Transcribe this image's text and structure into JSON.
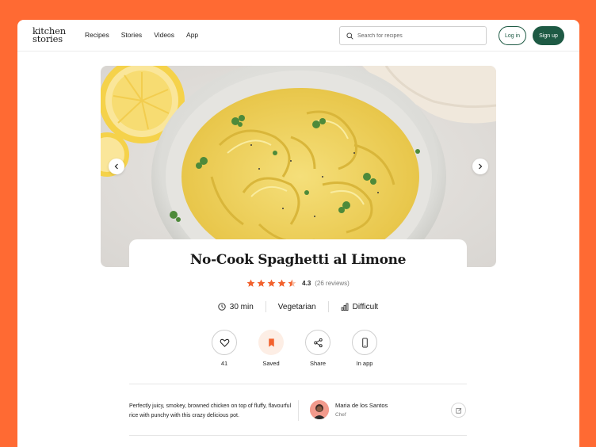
{
  "brand": {
    "line1": "kitchen",
    "line2": "stories"
  },
  "nav": [
    {
      "label": "Recipes"
    },
    {
      "label": "Stories"
    },
    {
      "label": "Videos"
    },
    {
      "label": "App"
    }
  ],
  "search": {
    "placeholder": "Search for recipes",
    "icon": "search-icon"
  },
  "auth": {
    "login_label": "Log in",
    "signup_label": "Sign up"
  },
  "colors": {
    "accent": "#ff6a33",
    "brand_green": "#1e5a44",
    "star": "#f2622e",
    "saved_bg": "#fdeee5"
  },
  "recipe": {
    "title": "No-Cook Spaghetti al Limone",
    "rating": {
      "value": "4.3",
      "count": "(26 reviews)",
      "stars": 4.5,
      "max": 5
    },
    "meta": {
      "time": "30 min",
      "diet": "Vegetarian",
      "difficulty": "Difficult"
    },
    "actions": [
      {
        "label": "41",
        "icon": "heart-icon"
      },
      {
        "label": "Saved",
        "icon": "bookmark-icon"
      },
      {
        "label": "Share",
        "icon": "share-icon"
      },
      {
        "label": "In app",
        "icon": "phone-icon"
      }
    ],
    "description": "Perfectly juicy, smokey, browned chicken on top of fluffy, flavourful rice with punchy with this crazy delicious pot.",
    "author": {
      "name": "Maria de los Santos",
      "role": "Chef"
    }
  }
}
